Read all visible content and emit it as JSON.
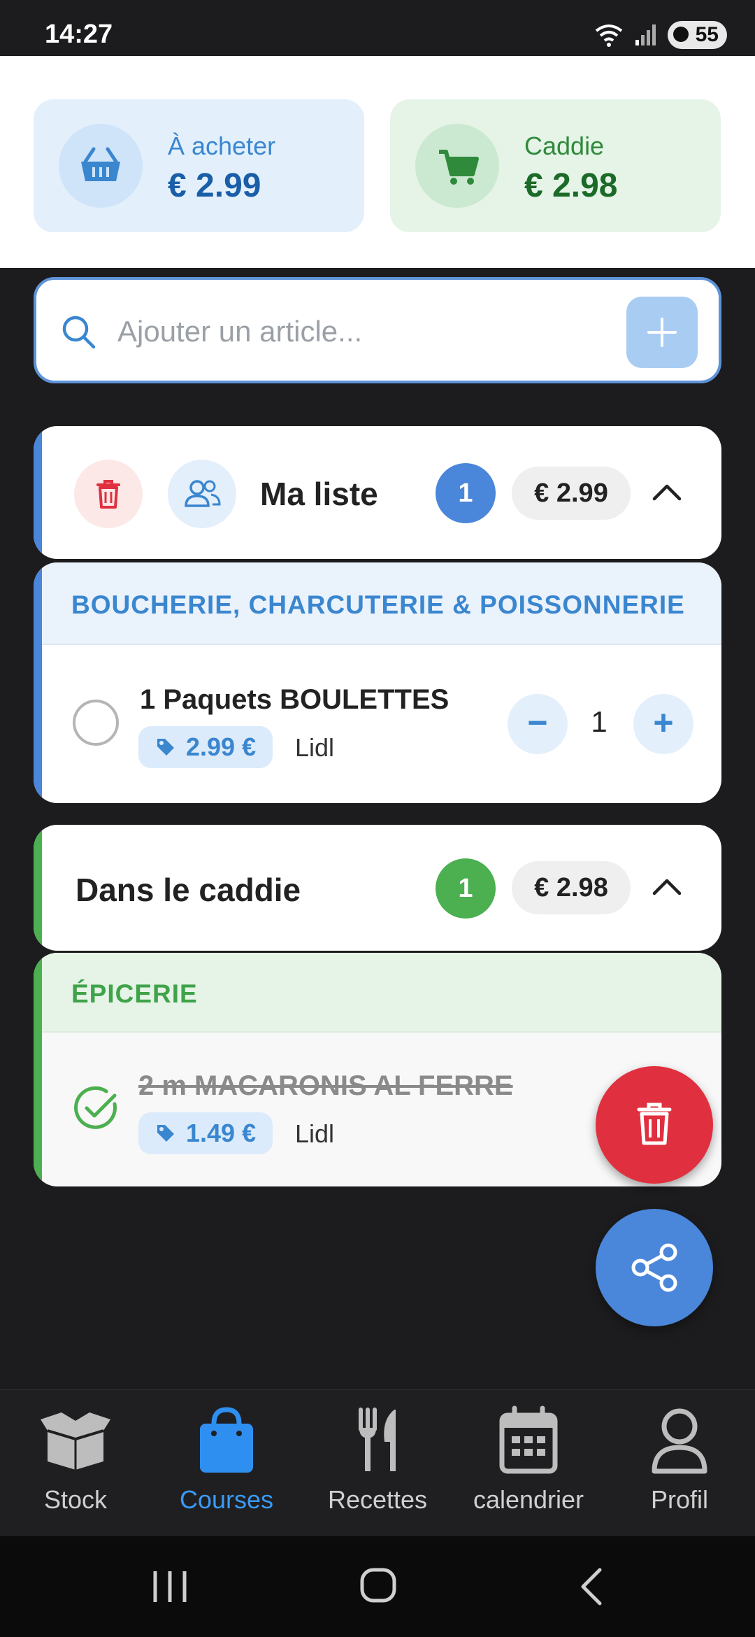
{
  "status": {
    "time": "14:27",
    "battery": "55"
  },
  "summary": {
    "to_buy": {
      "label": "À acheter",
      "value": "€ 2.99"
    },
    "cart": {
      "label": "Caddie",
      "value": "€ 2.98"
    }
  },
  "search": {
    "placeholder": "Ajouter un article..."
  },
  "my_list": {
    "title": "Ma liste",
    "count": "1",
    "total": "€ 2.99",
    "category": "BOUCHERIE, CHARCUTERIE & POISSONNERIE",
    "item": {
      "name": "1 Paquets  BOULETTES",
      "price": "2.99 €",
      "store": "Lidl",
      "quantity": "1",
      "minus": "−",
      "plus": "+"
    }
  },
  "cart_list": {
    "title": "Dans le caddie",
    "count": "1",
    "total": "€ 2.98",
    "category": "ÉPICERIE",
    "item": {
      "name": "2 m  MACARONIS AL FERRE",
      "price": "1.49 €",
      "store": "Lidl"
    }
  },
  "nav": [
    {
      "label": "Stock",
      "icon": "box-icon"
    },
    {
      "label": "Courses",
      "icon": "shopping-bag-icon"
    },
    {
      "label": "Recettes",
      "icon": "fork-knife-icon"
    },
    {
      "label": "calendrier",
      "icon": "calendar-icon"
    },
    {
      "label": "Profil",
      "icon": "user-icon"
    }
  ],
  "colors": {
    "blue": "#3a86cf",
    "green": "#4caf50",
    "red": "#e0303f",
    "active_nav": "#3a9af5"
  }
}
